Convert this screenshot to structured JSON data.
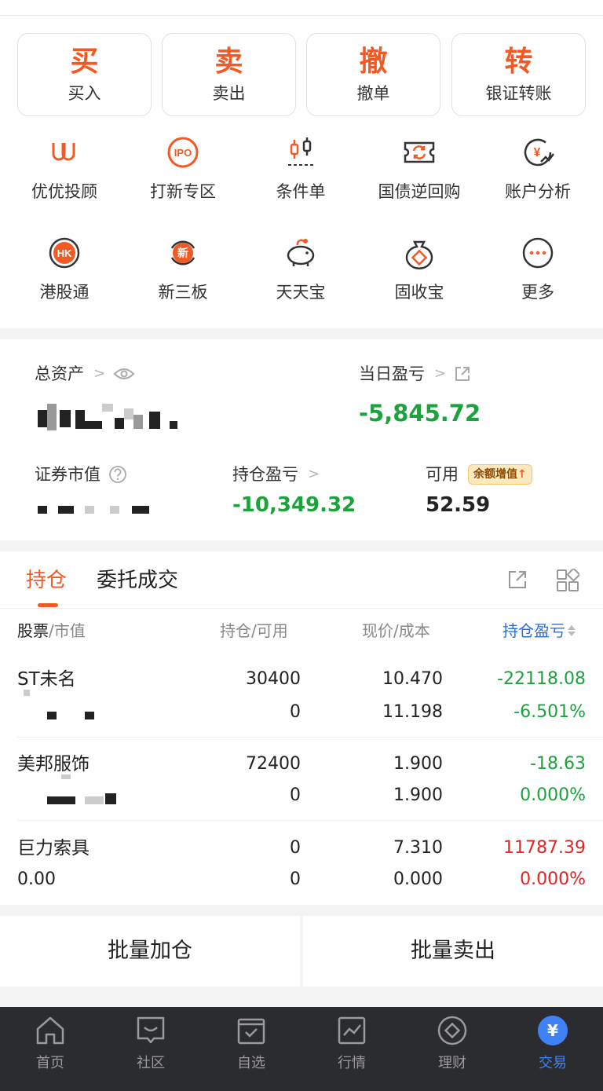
{
  "quick_actions": [
    {
      "glyph": "买",
      "label": "买入"
    },
    {
      "glyph": "卖",
      "label": "卖出"
    },
    {
      "glyph": "撤",
      "label": "撤单"
    },
    {
      "glyph": "转",
      "label": "银证转账"
    }
  ],
  "tools": [
    {
      "label": "优优投顾",
      "icon": "youyou-icon"
    },
    {
      "label": "打新专区",
      "icon": "ipo-icon",
      "icon_text": "IPO"
    },
    {
      "label": "条件单",
      "icon": "candlestick-icon"
    },
    {
      "label": "国债逆回购",
      "icon": "ticket-cycle-icon"
    },
    {
      "label": "账户分析",
      "icon": "yen-chart-icon",
      "icon_text": "¥"
    },
    {
      "label": "港股通",
      "icon": "hk-icon",
      "icon_text": "HK"
    },
    {
      "label": "新三板",
      "icon": "new-board-icon",
      "icon_text": "新"
    },
    {
      "label": "天天宝",
      "icon": "piggy-bank-icon"
    },
    {
      "label": "固收宝",
      "icon": "money-bag-icon"
    },
    {
      "label": "更多",
      "icon": "more-icon",
      "icon_text": "···"
    }
  ],
  "assets": {
    "total_label": "总资产",
    "daily_pl_label": "当日盈亏",
    "daily_pl_value": "-5,845.72",
    "market_value_label": "证券市值",
    "position_pl_label": "持仓盈亏",
    "position_pl_value": "-10,349.32",
    "available_label": "可用",
    "available_value": "52.59",
    "badge": "余额增值"
  },
  "holdings": {
    "tabs": [
      "持仓",
      "委托成交"
    ],
    "columns": {
      "stock": "股票",
      "market_value": "/市值",
      "qty": "持仓/可用",
      "price": "现价/成本",
      "pl": "持仓盈亏"
    },
    "rows": [
      {
        "name": "ST未名",
        "sub": "",
        "qty": "30400",
        "avail": "0",
        "price": "10.470",
        "cost": "11.198",
        "pl": "-22118.08",
        "pl_pct": "-6.501%",
        "pl_color": "green",
        "pct_color": "green"
      },
      {
        "name": "美邦服饰",
        "sub": "",
        "qty": "72400",
        "avail": "0",
        "price": "1.900",
        "cost": "1.900",
        "pl": "-18.63",
        "pl_pct": "0.000%",
        "pl_color": "green",
        "pct_color": "green"
      },
      {
        "name": "巨力索具",
        "sub": "0.00",
        "qty": "0",
        "avail": "0",
        "price": "7.310",
        "cost": "0.000",
        "pl": "11787.39",
        "pl_pct": "0.000%",
        "pl_color": "red",
        "pct_color": "red"
      }
    ]
  },
  "batch": {
    "add": "批量加仓",
    "sell": "批量卖出"
  },
  "nav": [
    {
      "label": "首页",
      "icon": "home-icon"
    },
    {
      "label": "社区",
      "icon": "community-icon"
    },
    {
      "label": "自选",
      "icon": "watchlist-icon"
    },
    {
      "label": "行情",
      "icon": "market-icon"
    },
    {
      "label": "理财",
      "icon": "wealth-icon"
    },
    {
      "label": "交易",
      "icon": "trade-icon",
      "icon_text": "¥",
      "active": true
    }
  ],
  "colors": {
    "accent": "#f15a24",
    "loss": "#1ba33c",
    "gain": "#e32424",
    "nav_active": "#3f82f7",
    "nav_bg": "#2b2c30"
  }
}
